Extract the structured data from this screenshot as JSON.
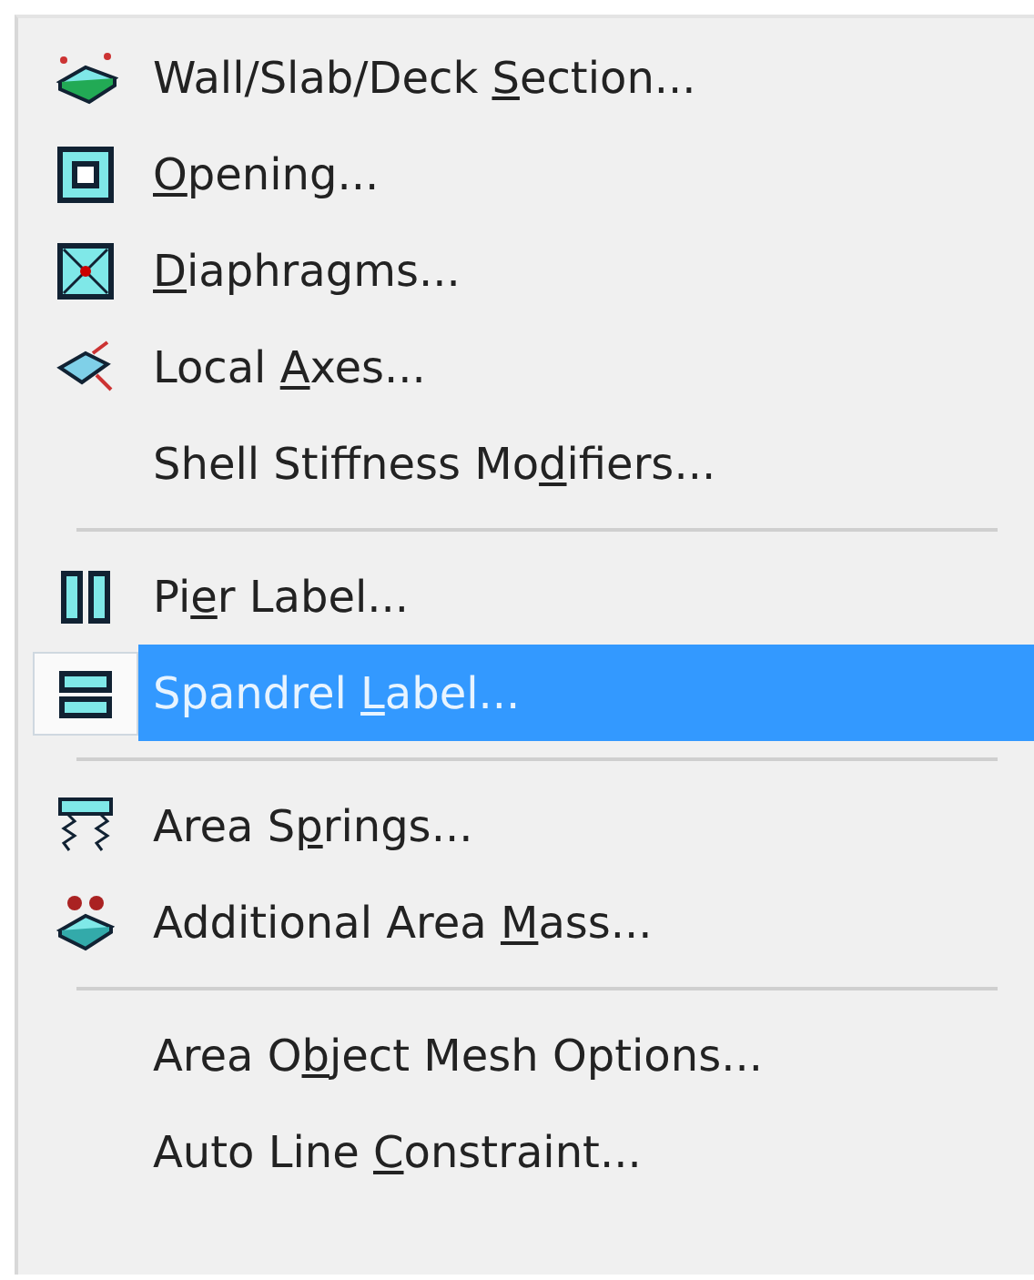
{
  "menu": {
    "entries": [
      {
        "kind": "item",
        "before": "Wall/Slab/Deck ",
        "key": "S",
        "after": "ection...",
        "selected": false
      },
      {
        "kind": "item",
        "key": "O",
        "after": "pening...",
        "selected": false
      },
      {
        "kind": "item",
        "key": "D",
        "after": "iaphragms...",
        "selected": false
      },
      {
        "kind": "item",
        "before": "Local ",
        "key": "A",
        "after": "xes...",
        "selected": false
      },
      {
        "kind": "item",
        "before": "Shell Stiffness Mo",
        "key": "d",
        "after": "ifiers...",
        "selected": false
      },
      {
        "kind": "separator"
      },
      {
        "kind": "item",
        "before": "Pi",
        "key": "e",
        "after": "r Label...",
        "selected": false
      },
      {
        "kind": "item",
        "before": "Spandrel ",
        "key": "L",
        "after": "abel...",
        "selected": true
      },
      {
        "kind": "separator"
      },
      {
        "kind": "item",
        "before": "Area S",
        "key": "p",
        "after": "rings...",
        "selected": false
      },
      {
        "kind": "item",
        "before": "Additional Area ",
        "key": "M",
        "after": "ass...",
        "selected": false
      },
      {
        "kind": "separator"
      },
      {
        "kind": "item",
        "before": "Area O",
        "key": "b",
        "after": "ject Mesh Options...",
        "selected": false
      },
      {
        "kind": "item",
        "before": "Auto Line ",
        "key": "C",
        "after": "onstraint...",
        "selected": false
      }
    ]
  }
}
